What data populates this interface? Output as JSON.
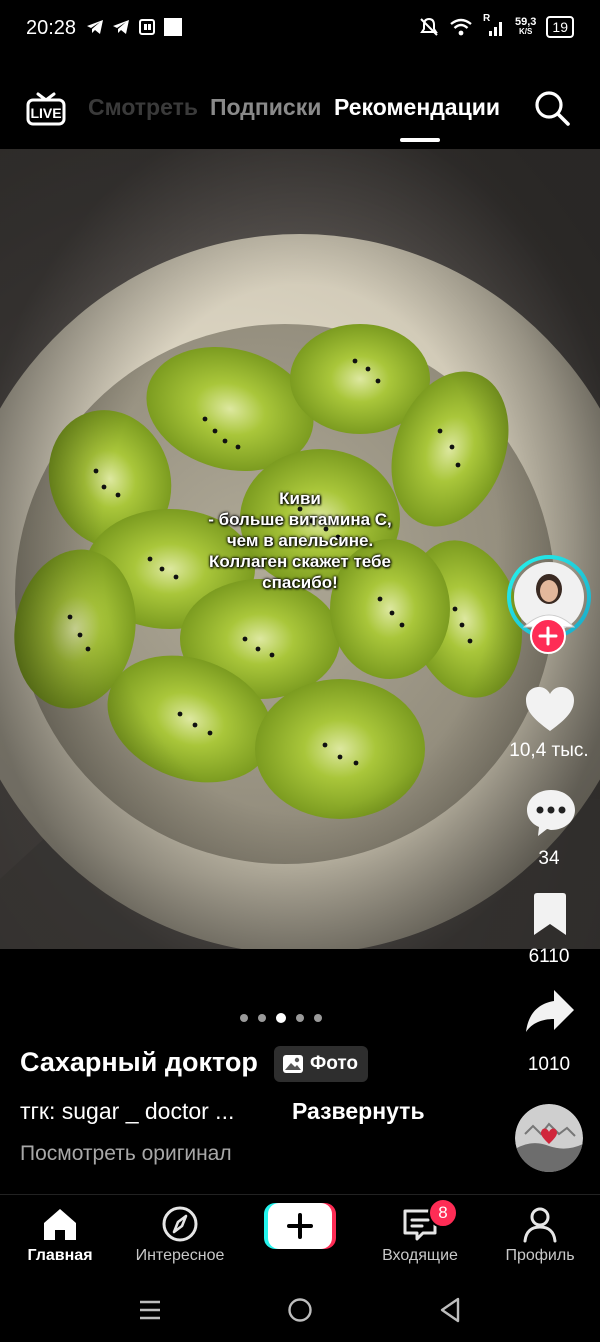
{
  "status_bar": {
    "time": "20:28",
    "network_speed_value": "59,3",
    "network_speed_unit": "K/S",
    "signal_label": "R",
    "battery": "19"
  },
  "top_nav": {
    "tabs": [
      "Смотреть",
      "Подписки",
      "Рекомендации"
    ],
    "active_tab": "Рекомендации",
    "live_label": "LIVE"
  },
  "post": {
    "caption": "Киви\n- больше витамина С,\nчем в апельсине.\nКоллаген скажет тебе\nспасибо!",
    "author": "Сахарный доктор",
    "badge": "Фото",
    "description": "тгк: sugar _ doctor ...",
    "expand_label": "Развернуть",
    "original_label": "Посмотреть оригинал",
    "slides_total": 5,
    "current_slide": 3
  },
  "actions": {
    "likes": "10,4 тыс.",
    "comments": "34",
    "saves": "6110",
    "shares": "1010"
  },
  "bottom_nav": {
    "items": [
      {
        "label": "Главная",
        "icon": "home-icon"
      },
      {
        "label": "Интересное",
        "icon": "compass-icon"
      },
      {
        "label": "",
        "icon": "create-plus-icon"
      },
      {
        "label": "Входящие",
        "icon": "inbox-icon",
        "badge": "8"
      },
      {
        "label": "Профиль",
        "icon": "profile-icon"
      }
    ]
  },
  "colors": {
    "accent_red": "#fe2c55",
    "accent_cyan": "#25f4ee",
    "background": "#000000"
  }
}
